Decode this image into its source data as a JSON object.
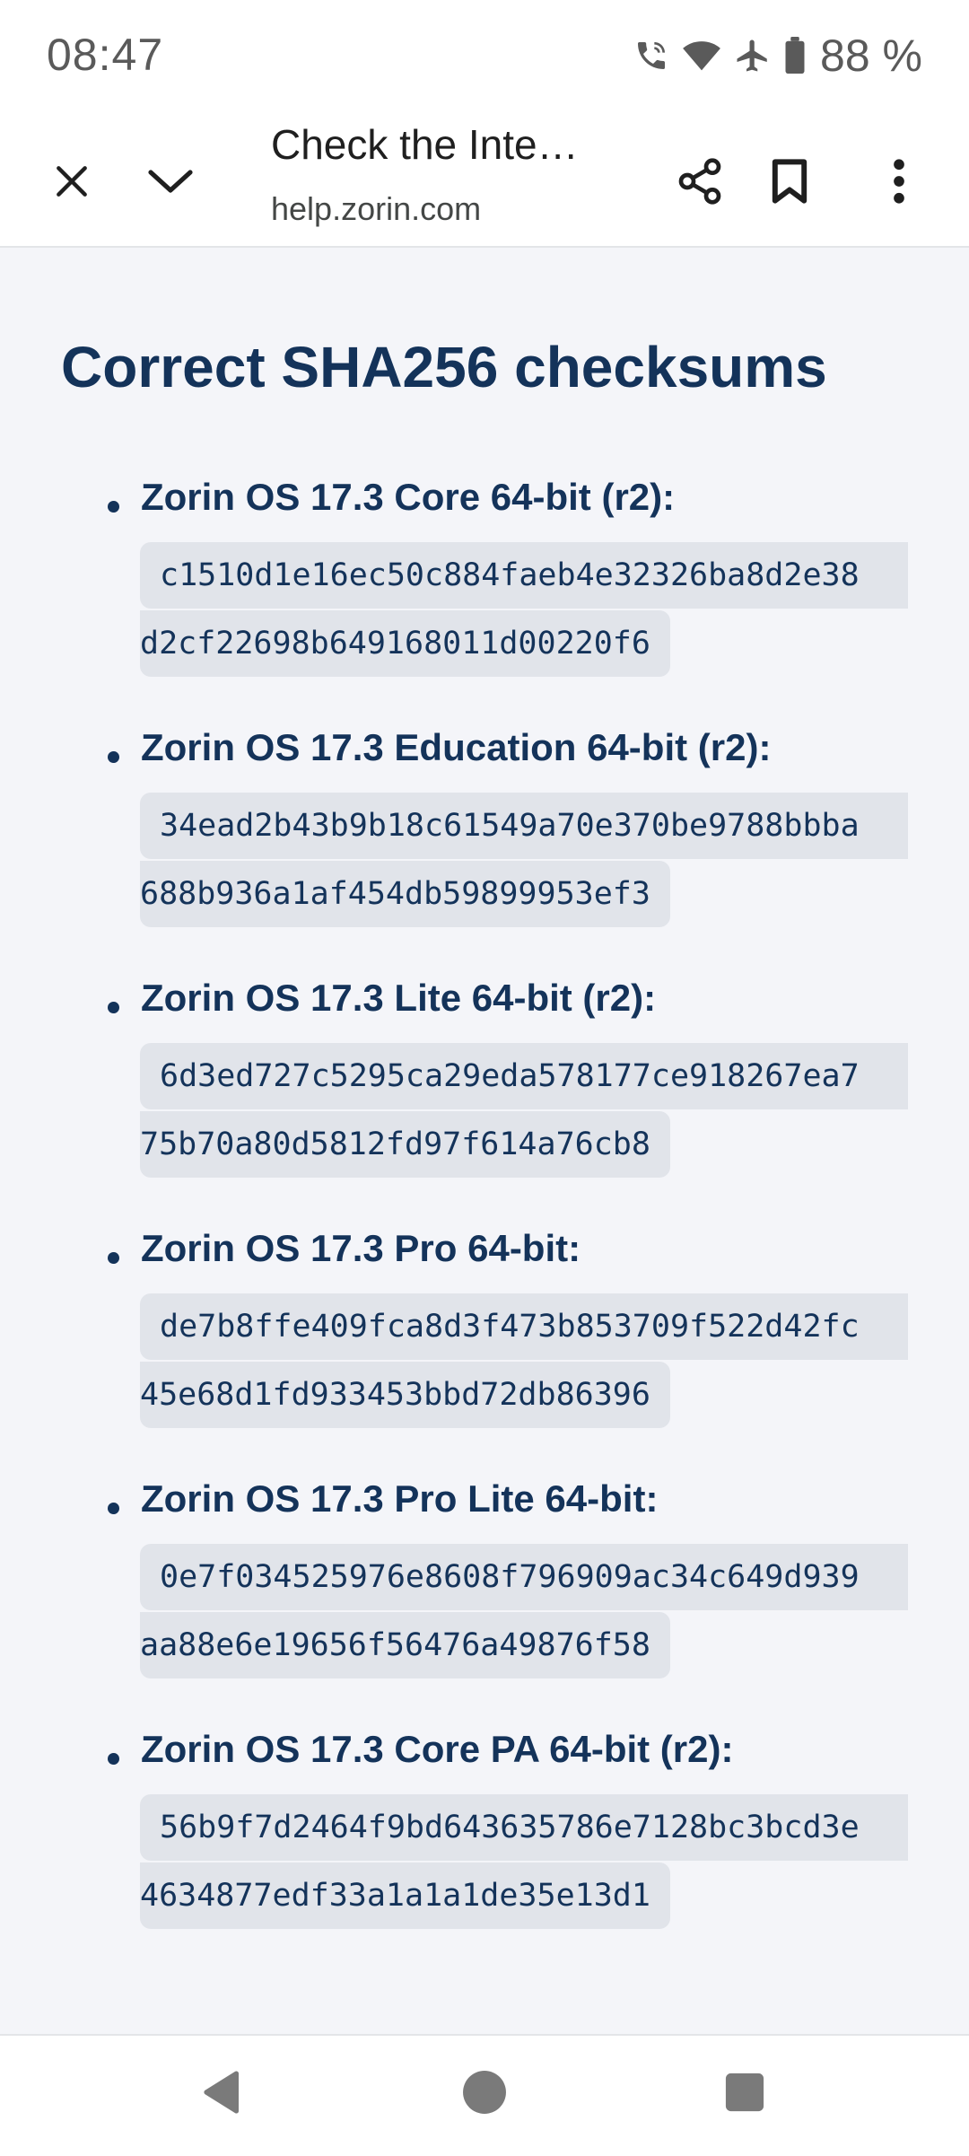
{
  "status_bar": {
    "time": "08:47",
    "battery": "88 %",
    "icons": [
      "wifi-calling-icon",
      "wifi-icon",
      "airplane-mode-icon",
      "battery-icon"
    ]
  },
  "toolbar": {
    "title": "Check the Inte…",
    "url": "help.zorin.com",
    "icons": [
      "close-icon",
      "chevron-down-icon",
      "share-icon",
      "bookmark-icon",
      "more-vert-icon"
    ]
  },
  "content": {
    "heading": "Correct SHA256 checksums",
    "items": [
      {
        "label": "Zorin OS 17.3 Core 64-bit (r2):",
        "hash_line1": "c1510d1e16ec50c884faeb4e32326ba8d2e38",
        "hash_line2": "d2cf22698b649168011d00220f6"
      },
      {
        "label": "Zorin OS 17.3 Education 64-bit (r2):",
        "hash_line1": "34ead2b43b9b18c61549a70e370be9788bbba",
        "hash_line2": "688b936a1af454db59899953ef3"
      },
      {
        "label": "Zorin OS 17.3 Lite 64-bit (r2):",
        "hash_line1": "6d3ed727c5295ca29eda578177ce918267ea7",
        "hash_line2": "75b70a80d5812fd97f614a76cb8"
      },
      {
        "label": "Zorin OS 17.3 Pro 64-bit:",
        "hash_line1": "de7b8ffe409fca8d3f473b853709f522d42fc",
        "hash_line2": "45e68d1fd933453bbd72db86396"
      },
      {
        "label": "Zorin OS 17.3 Pro Lite 64-bit:",
        "hash_line1": "0e7f034525976e8608f796909ac34c649d939",
        "hash_line2": "aa88e6e19656f56476a49876f58"
      },
      {
        "label": "Zorin OS 17.3 Core PA 64-bit (r2):",
        "hash_line1": "56b9f7d2464f9bd643635786e7128bc3bcd3e",
        "hash_line2": "4634877edf33a1a1a1de35e13d1"
      }
    ]
  },
  "nav_bar": {
    "icons": [
      "back-icon",
      "home-icon",
      "recents-icon"
    ]
  },
  "colors": {
    "heading": "#14335a",
    "page_background": "#f4f5f9",
    "code_background": "#e1e4ea"
  }
}
